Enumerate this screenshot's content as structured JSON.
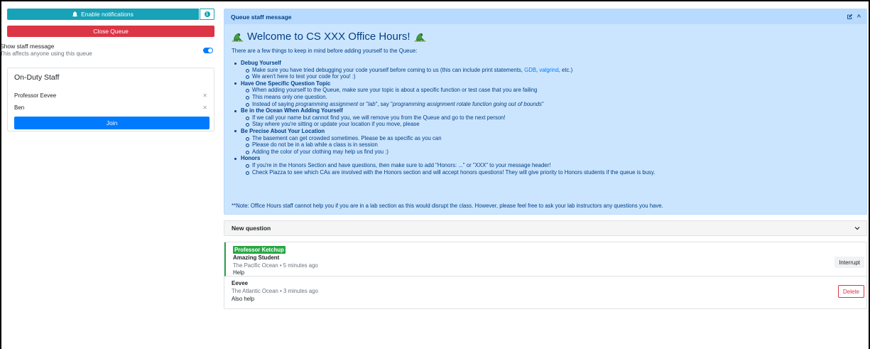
{
  "sidebar": {
    "notifications_label": "Enable notifications",
    "close_queue_label": "Close Queue",
    "show_staff_message_label": "Show staff message",
    "show_staff_message_hint": "This affects anyone using this queue",
    "show_staff_message_on": true,
    "on_duty": {
      "title": "On-Duty Staff",
      "staff": [
        "Professor Eevee",
        "Ben"
      ],
      "join_label": "Join"
    }
  },
  "staff_message": {
    "header": "Queue staff message",
    "welcome": "Welcome to CS XXX Office Hours!",
    "intro": "There are a few things to keep in mind before adding yourself to the Queue:",
    "note": "**Note: Office Hours staff cannot help you if you are in a lab section as this would disrupt the class. However, please feel free to ask your lab instructors any questions you have."
  },
  "rules": {
    "debug": {
      "heading": "Debug Yourself",
      "s1_pre": "Make sure you have tried debugging your code yourself before coming to us (this can include print statements, ",
      "gdb": "GDB",
      "comma": ", ",
      "valgrind": "valgrind",
      "s1_post": ", etc.)",
      "s2": "We aren't here to test your code for you! :)"
    },
    "topic": {
      "heading": "Have One Specific Question Topic",
      "s1": "When adding yourself to the Queue, make sure your topic is about a specific function or test case that you are failing",
      "s2": "This means only one question.",
      "s3_a": "Instead of saying ",
      "s3_b": "programming assignment",
      "s3_c": " or \"",
      "s3_d": "lab",
      "s3_e": "\", say \"",
      "s3_f": "programming assignment rotate function going out of bounds",
      "s3_g": "\""
    },
    "ocean": {
      "heading": "Be in the Ocean When Adding Yourself",
      "s1": "If we call your name but cannot find you, we will remove you from the Queue and go to the next person!",
      "s2": "Stay where you're sitting or update your location if you move, please"
    },
    "location": {
      "heading": "Be Precise About Your Location",
      "s1": "The basement can get crowded sometimes. Please be as specific as you can",
      "s2": "Please do not be in a lab while a class is in session",
      "s3": "Adding the color of your clothing may help us find you :)"
    },
    "honors": {
      "heading": "Honors",
      "s1": "If you're in the Honors Section and have questions, then make sure to add \"Honors: ...\" or \"XXX\" to your message header!",
      "s2": "Check Piazza to see which CAs are involved with the Honors section and will accept honors questions! They will give priority to Honors students if the queue is busy."
    }
  },
  "new_question": {
    "label": "New question"
  },
  "questions": [
    {
      "answerer": "Professor Ketchup",
      "name": "Amazing Student",
      "location": "The Pacific Ocean",
      "time": "5 minutes ago",
      "topic": "Help",
      "action": "Interrupt"
    },
    {
      "name": "Eevee",
      "location": "The Atlantic Ocean",
      "time": "3 minutes ago",
      "topic": "Also help",
      "action": "Delete"
    }
  ],
  "meta_separator": " • ",
  "colors": {
    "primary": "#007bff",
    "danger": "#dc3545",
    "info": "#17a2b8",
    "success": "#28a745",
    "alert_bg": "#cce5ff",
    "alert_text": "#004085"
  },
  "icons": {
    "bell": "bell-icon",
    "info": "info-icon",
    "edit": "edit-icon",
    "collapse": "chevron-up-icon",
    "expand": "chevron-down-icon",
    "remove": "close-icon",
    "dino": "dinosaur-icon"
  }
}
